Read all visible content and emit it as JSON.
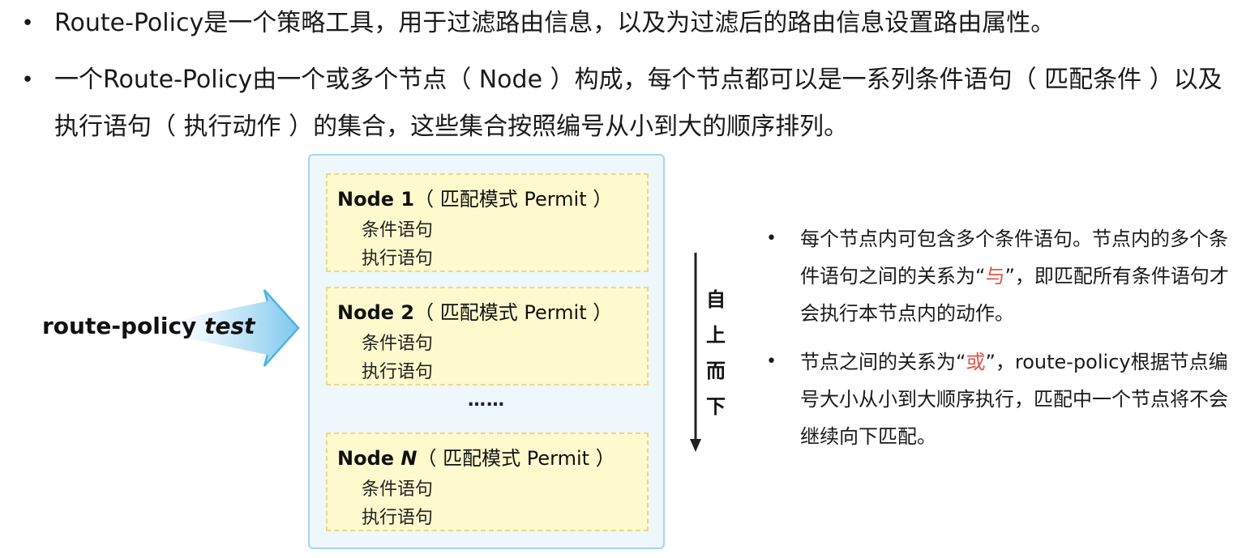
{
  "bullets": [
    {
      "text": "Route-Policy是一个策略工具，用于过滤路由信息，以及为过滤后的路由信息设置路由属性。"
    },
    {
      "text": "一个Route-Policy由一个或多个节点（ Node ）构成，每个节点都可以是一系列条件语句（ 匹配条件 ）以及执行语句（ 执行动作 ）的集合，这些集合按照编号从小到大的顺序排列。"
    }
  ],
  "bullet_symbol": "•",
  "policy": {
    "keyword": "route-policy",
    "name": "test"
  },
  "nodes": [
    {
      "label": "Node 1",
      "mode": "（ 匹配模式 Permit ）",
      "line1": "条件语句",
      "line2": "执行语句"
    },
    {
      "label": "Node 2",
      "mode": "（ 匹配模式 Permit ）",
      "line1": "条件语句",
      "line2": "执行语句"
    },
    {
      "label_prefix": "Node ",
      "label_var": "N",
      "mode": "（ 匹配模式 Permit ）",
      "line1": "条件语句",
      "line2": "执行语句"
    }
  ],
  "ellipsis": "……",
  "direction": [
    "自",
    "上",
    "而",
    "下"
  ],
  "notes": [
    {
      "before": "每个节点内可包含多个条件语句。节点内的多个条件语句之间的关系为“",
      "highlight": "与",
      "after": "”，即匹配所有条件语句才会执行本节点内的动作。"
    },
    {
      "before": "节点之间的关系为“",
      "highlight": "或",
      "after": "”，route-policy根据节点编号大小从小到大顺序执行，匹配中一个节点将不会继续向下匹配。"
    }
  ],
  "colors": {
    "highlight": "#e2554a",
    "node_fill": "#fffacd",
    "container_fill": "#eef7fc",
    "container_border": "#a9d6ee",
    "arrow_blue": "#4fb3e8"
  }
}
